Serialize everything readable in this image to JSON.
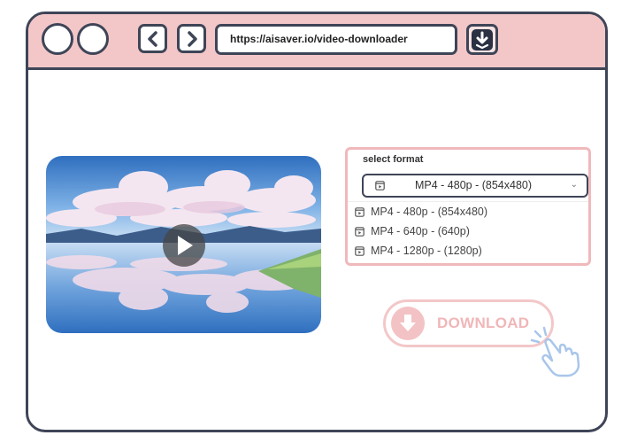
{
  "browser": {
    "url": "https://aisaver.io/video-downloader"
  },
  "format_panel": {
    "label": "select format",
    "selected": "MP4 - 480p - (854x480)",
    "options": [
      "MP4 - 480p - (854x480)",
      "MP4 - 640p - (640p)",
      "MP4 - 1280p - (1280p)"
    ]
  },
  "download": {
    "label": "DOWNLOAD"
  },
  "colors": {
    "titlebar": "#f3c7c8",
    "outline": "#3f4557",
    "accent_pink": "#f1b6b8"
  },
  "icons": {
    "back": "chevron-left-icon",
    "forward": "chevron-right-icon",
    "download_ext": "download-arrow-icon",
    "format": "video-file-icon",
    "play": "play-icon",
    "cursor": "pointing-hand-icon"
  }
}
